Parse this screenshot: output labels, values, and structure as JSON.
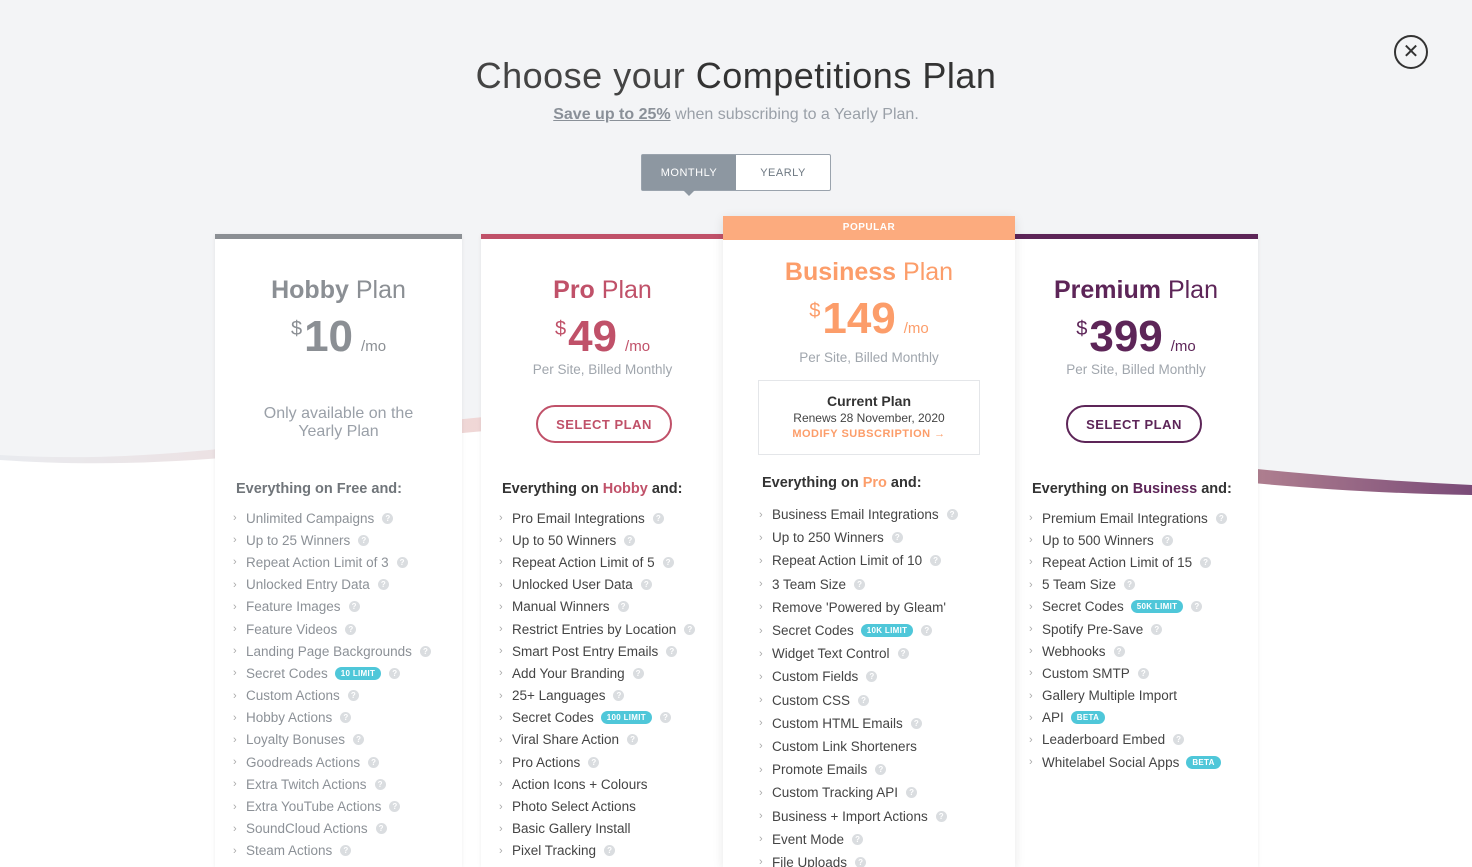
{
  "header": {
    "title_light": "Choose your ",
    "title_bold": "Competitions Plan",
    "save_text": "Save up to 25%",
    "subtitle_rest": " when subscribing to a Yearly Plan."
  },
  "toggle": {
    "monthly": "MONTHLY",
    "yearly": "YEARLY",
    "active": "monthly"
  },
  "colors": {
    "hobby": "#8b8f94",
    "pro": "#c05169",
    "business": "#fc9d6a",
    "premium": "#5d2558",
    "badge": "#4fc7d9"
  },
  "plans": {
    "hobby": {
      "name": "Hobby",
      "plan_word": "Plan",
      "currency": "$",
      "price": "10",
      "period": "/mo",
      "note": "Only available on the Yearly Plan",
      "everything_prefix": "Everything on ",
      "everything_plan": "Free",
      "everything_suffix": " and:",
      "features": [
        {
          "label": "Unlimited Campaigns",
          "help": true
        },
        {
          "label": "Up to 25 Winners",
          "help": true
        },
        {
          "label": "Repeat Action Limit of 3",
          "help": true
        },
        {
          "label": "Unlocked Entry Data",
          "help": true
        },
        {
          "label": "Feature Images",
          "help": true
        },
        {
          "label": "Feature Videos",
          "help": true
        },
        {
          "label": "Landing Page Backgrounds",
          "help": true
        },
        {
          "label": "Secret Codes",
          "badge": "10 LIMIT",
          "help": true
        },
        {
          "label": "Custom Actions",
          "help": true
        },
        {
          "label": "Hobby Actions",
          "help": true
        },
        {
          "label": "Loyalty Bonuses",
          "help": true
        },
        {
          "label": "Goodreads Actions",
          "help": true
        },
        {
          "label": "Extra Twitch Actions",
          "help": true
        },
        {
          "label": "Extra YouTube Actions",
          "help": true
        },
        {
          "label": "SoundCloud Actions",
          "help": true
        },
        {
          "label": "Steam Actions",
          "help": true
        }
      ]
    },
    "pro": {
      "name": "Pro",
      "plan_word": "Plan",
      "currency": "$",
      "price": "49",
      "period": "/mo",
      "billed": "Per Site, Billed Monthly",
      "button": "SELECT PLAN",
      "everything_prefix": "Everything on ",
      "everything_plan": "Hobby",
      "everything_suffix": " and:",
      "features": [
        {
          "label": "Pro Email Integrations",
          "help": true
        },
        {
          "label": "Up to 50 Winners",
          "help": true
        },
        {
          "label": "Repeat Action Limit of 5",
          "help": true
        },
        {
          "label": "Unlocked User Data",
          "help": true
        },
        {
          "label": "Manual Winners",
          "help": true
        },
        {
          "label": "Restrict Entries by Location",
          "help": true
        },
        {
          "label": "Smart Post Entry Emails",
          "help": true
        },
        {
          "label": "Add Your Branding",
          "help": true
        },
        {
          "label": "25+ Languages",
          "help": true
        },
        {
          "label": "Secret Codes",
          "badge": "100 LIMIT",
          "help": true
        },
        {
          "label": "Viral Share Action",
          "help": true
        },
        {
          "label": "Pro Actions",
          "help": true
        },
        {
          "label": "Action Icons + Colours",
          "help": false
        },
        {
          "label": "Photo Select Actions",
          "help": false
        },
        {
          "label": "Basic Gallery Install",
          "help": false
        },
        {
          "label": "Pixel Tracking",
          "help": true
        }
      ]
    },
    "business": {
      "popular": "POPULAR",
      "name": "Business",
      "plan_word": "Plan",
      "currency": "$",
      "price": "149",
      "period": "/mo",
      "billed": "Per Site, Billed Monthly",
      "current_title": "Current Plan",
      "current_renews": "Renews 28 November, 2020",
      "modify": "MODIFY SUBSCRIPTION",
      "everything_prefix": "Everything on ",
      "everything_plan": "Pro",
      "everything_suffix": " and:",
      "features": [
        {
          "label": "Business Email Integrations",
          "help": true
        },
        {
          "label": "Up to 250 Winners",
          "help": true
        },
        {
          "label": "Repeat Action Limit of 10",
          "help": true
        },
        {
          "label": "3 Team Size",
          "help": true
        },
        {
          "label": "Remove 'Powered by Gleam'",
          "help": false
        },
        {
          "label": "Secret Codes",
          "badge": "10K LIMIT",
          "help": true
        },
        {
          "label": "Widget Text Control",
          "help": true
        },
        {
          "label": "Custom Fields",
          "help": true
        },
        {
          "label": "Custom CSS",
          "help": true
        },
        {
          "label": "Custom HTML Emails",
          "help": true
        },
        {
          "label": "Custom Link Shorteners",
          "help": false
        },
        {
          "label": "Promote Emails",
          "help": true
        },
        {
          "label": "Custom Tracking API",
          "help": true
        },
        {
          "label": "Business + Import Actions",
          "help": true
        },
        {
          "label": "Event Mode",
          "help": true
        },
        {
          "label": "File Uploads",
          "help": true
        }
      ]
    },
    "premium": {
      "name": "Premium",
      "plan_word": "Plan",
      "currency": "$",
      "price": "399",
      "period": "/mo",
      "billed": "Per Site, Billed Monthly",
      "button": "SELECT PLAN",
      "everything_prefix": "Everything on ",
      "everything_plan": "Business",
      "everything_suffix": " and:",
      "features": [
        {
          "label": "Premium Email Integrations",
          "help": true
        },
        {
          "label": "Up to 500 Winners",
          "help": true
        },
        {
          "label": "Repeat Action Limit of 15",
          "help": true
        },
        {
          "label": "5 Team Size",
          "help": true
        },
        {
          "label": "Secret Codes",
          "badge": "50K LIMIT",
          "help": true
        },
        {
          "label": "Spotify Pre-Save",
          "help": true
        },
        {
          "label": "Webhooks",
          "help": true
        },
        {
          "label": "Custom SMTP",
          "help": true
        },
        {
          "label": "Gallery Multiple Import",
          "help": false
        },
        {
          "label": "API",
          "badge": "BETA",
          "help": false
        },
        {
          "label": "Leaderboard Embed",
          "help": true
        },
        {
          "label": "Whitelabel Social Apps",
          "badge": "BETA",
          "help": false
        }
      ]
    }
  }
}
